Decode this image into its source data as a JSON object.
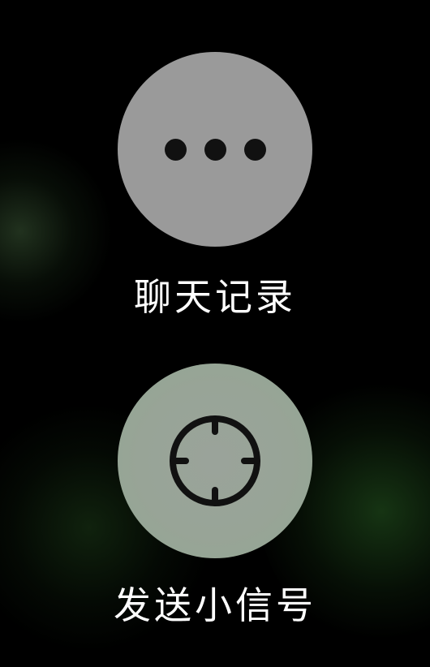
{
  "actions": {
    "chat_history": {
      "label": "聊天记录",
      "icon": "more-dots-icon"
    },
    "send_signal": {
      "label": "发送小信号",
      "icon": "crosshair-icon"
    }
  },
  "colors": {
    "background": "#000000",
    "button_fill": "#9a9a9a",
    "icon_fill": "#111111",
    "label_text": "#ffffff",
    "glow": "#2a5a24"
  }
}
